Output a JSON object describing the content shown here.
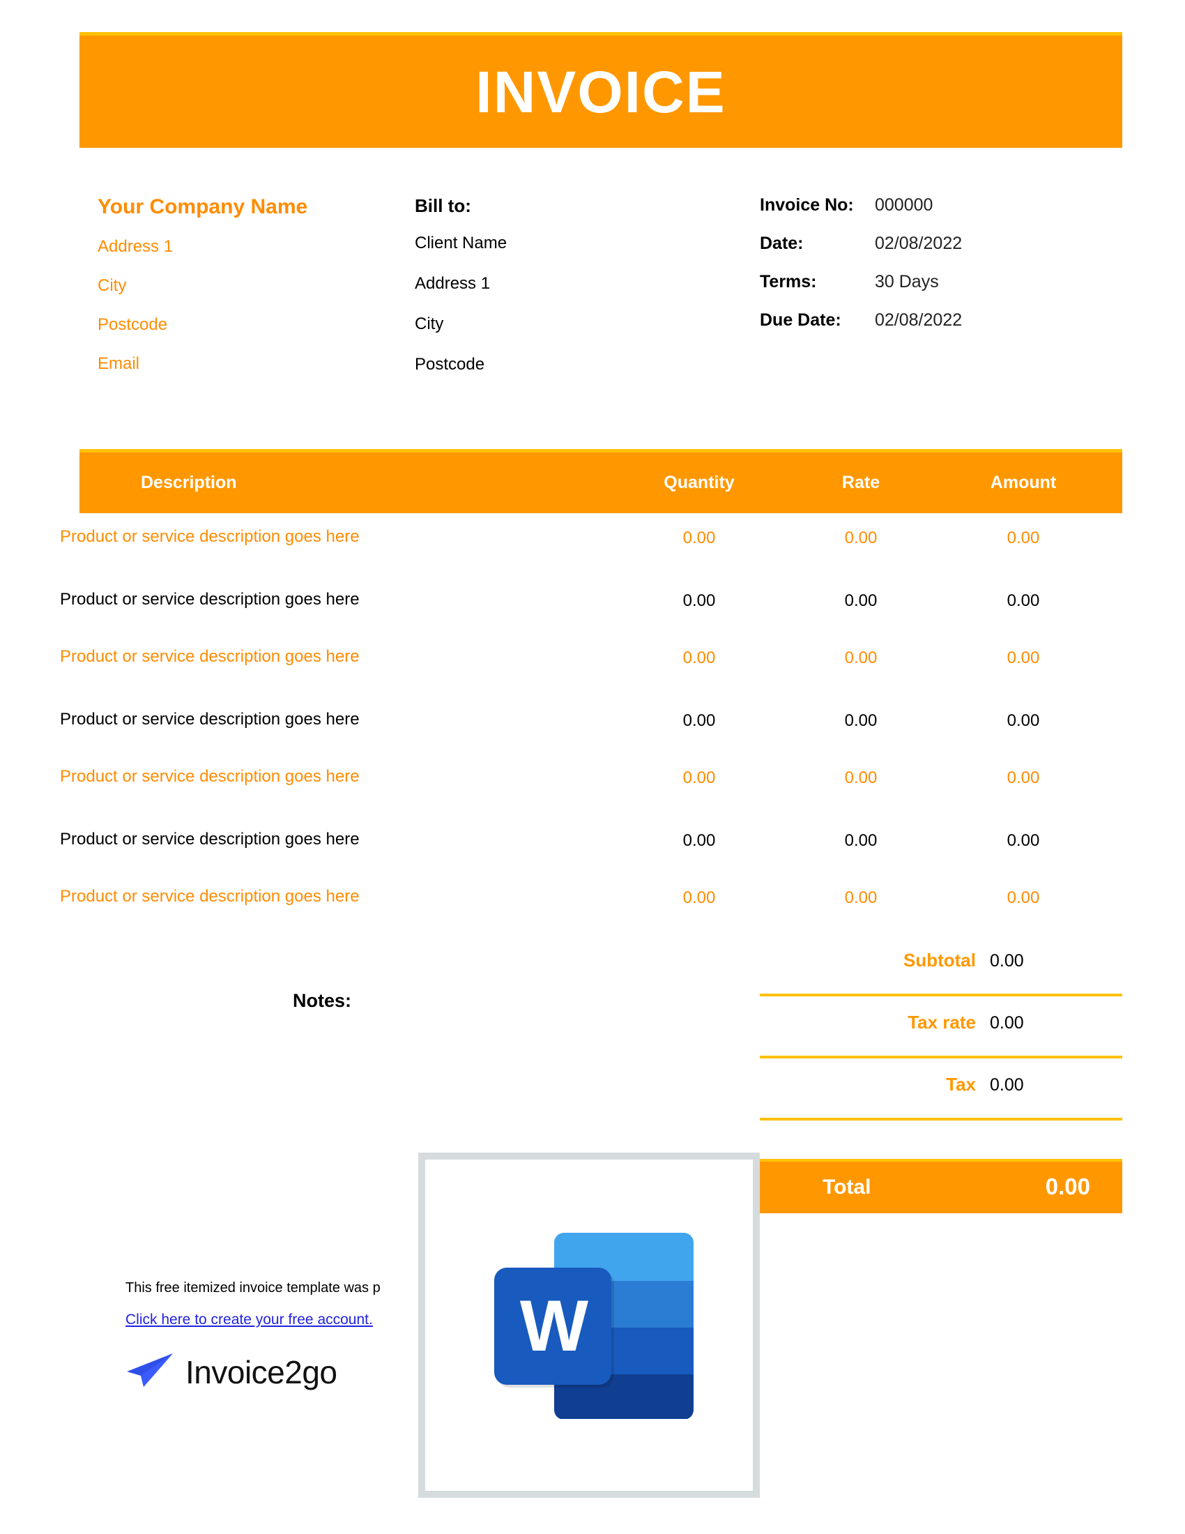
{
  "header": {
    "title": "INVOICE"
  },
  "company": {
    "name": "Your Company Name",
    "lines": [
      "Address 1",
      "City",
      "Postcode",
      "Email"
    ]
  },
  "bill_to": {
    "title": "Bill to:",
    "lines": [
      "Client Name",
      "Address 1",
      "City",
      "Postcode"
    ]
  },
  "meta": {
    "rows": [
      {
        "label": "Invoice No:",
        "value": "000000"
      },
      {
        "label": "Date:",
        "value": "02/08/2022"
      },
      {
        "label": "Terms:",
        "value": "30 Days"
      },
      {
        "label": "Due Date:",
        "value": "02/08/2022"
      }
    ]
  },
  "table": {
    "columns": [
      "Description",
      "Quantity",
      "Rate",
      "Amount"
    ],
    "rows": [
      {
        "description": "Product or service description goes here",
        "quantity": "0.00",
        "rate": "0.00",
        "amount": "0.00"
      },
      {
        "description": "Product or service description goes here",
        "quantity": "0.00",
        "rate": "0.00",
        "amount": "0.00"
      },
      {
        "description": "Product or service description goes here",
        "quantity": "0.00",
        "rate": "0.00",
        "amount": "0.00"
      },
      {
        "description": "Product or service description goes here",
        "quantity": "0.00",
        "rate": "0.00",
        "amount": "0.00"
      },
      {
        "description": "Product or service description goes here",
        "quantity": "0.00",
        "rate": "0.00",
        "amount": "0.00"
      },
      {
        "description": "Product or service description goes here",
        "quantity": "0.00",
        "rate": "0.00",
        "amount": "0.00"
      },
      {
        "description": "Product or service description goes here",
        "quantity": "0.00",
        "rate": "0.00",
        "amount": "0.00"
      }
    ]
  },
  "notes": {
    "label": "Notes:"
  },
  "totals": {
    "rows": [
      {
        "label": "Subtotal",
        "value": "0.00"
      },
      {
        "label": "Tax rate",
        "value": "0.00"
      },
      {
        "label": "Tax",
        "value": "0.00"
      }
    ],
    "total": {
      "label": "Total",
      "value": "0.00"
    }
  },
  "footer": {
    "text": "This free itemized invoice template was p",
    "link": "Click here to create your free account.",
    "brand": "Invoice2go"
  },
  "overlay": {
    "icon_letter": "W"
  },
  "colors": {
    "orange": "#FF9800",
    "amber": "#FFC107",
    "text_orange": "#FF8C00",
    "link_blue": "#2222DD",
    "card_border": "#D6DBDD",
    "word_blue": "#185ABD"
  }
}
